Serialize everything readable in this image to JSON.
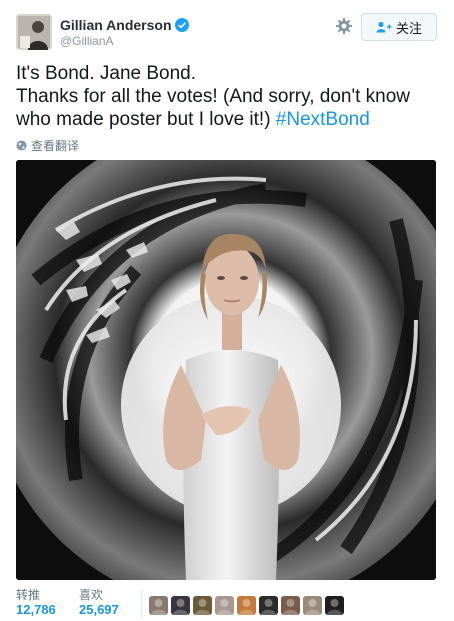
{
  "user": {
    "display_name": "Gillian Anderson",
    "handle": "@GillianA",
    "verified": true
  },
  "actions": {
    "follow_label": "关注",
    "settings_icon": "gear-icon",
    "follow_icon": "person-plus-icon"
  },
  "tweet": {
    "line1": "It's Bond. Jane Bond.",
    "line2": "Thanks for all the votes! (And sorry, don't know",
    "line3_prefix": "who made poster but I love it!) ",
    "hashtag": "#NextBond"
  },
  "translate": {
    "label": "查看翻译",
    "icon": "globe-icon"
  },
  "stats": {
    "retweets_label": "转推",
    "retweets_count": "12,786",
    "likes_label": "喜欢",
    "likes_count": "25,697"
  },
  "likers": [
    {
      "name": "liker-avatar-1",
      "color": "#8a7a6e"
    },
    {
      "name": "liker-avatar-2",
      "color": "#3b3340"
    },
    {
      "name": "liker-avatar-3",
      "color": "#6b5a3a"
    },
    {
      "name": "liker-avatar-4",
      "color": "#a89890"
    },
    {
      "name": "liker-avatar-5",
      "color": "#c27a3a"
    },
    {
      "name": "liker-avatar-6",
      "color": "#2b2b2b"
    },
    {
      "name": "liker-avatar-7",
      "color": "#7a5a4a"
    },
    {
      "name": "liker-avatar-8",
      "color": "#9a8a7a"
    },
    {
      "name": "liker-avatar-9",
      "color": "#1f1f1f"
    }
  ],
  "colors": {
    "link": "#1b95e0",
    "verified": "#1da1f2",
    "muted": "#657786"
  }
}
